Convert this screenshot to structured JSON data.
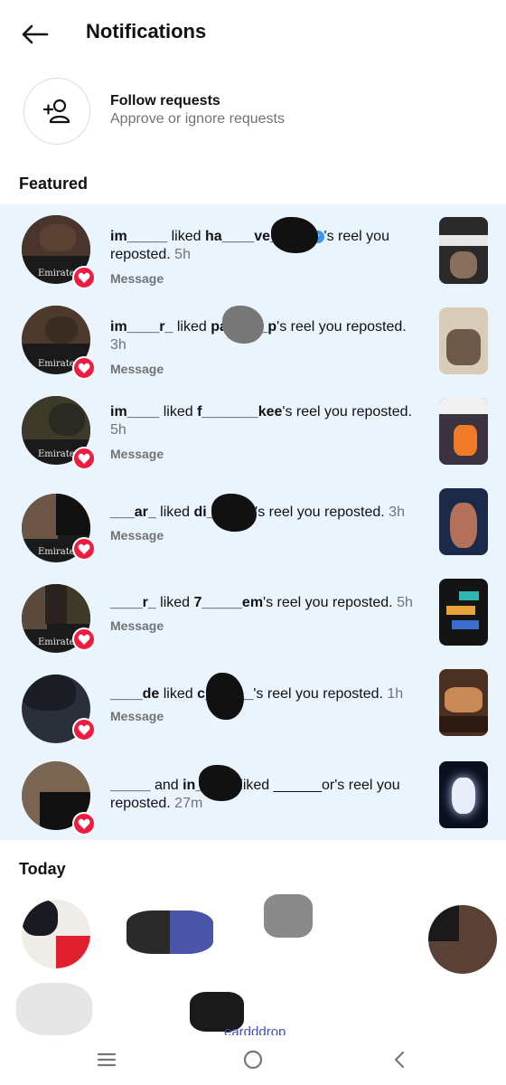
{
  "header": {
    "title": "Notifications",
    "back_icon": "arrow-left-icon"
  },
  "follow_requests": {
    "title": "Follow requests",
    "subtitle": "Approve or ignore requests",
    "icon": "add-person-icon"
  },
  "sections": {
    "featured": "Featured",
    "today": "Today"
  },
  "colors": {
    "featured_bg": "#e9f4fc",
    "heart_badge": "#ed1c40",
    "secondary_text": "#737373",
    "verified_blue": "#3897f0"
  },
  "featured": [
    {
      "user": "im_____",
      "verb": "liked",
      "target": "ha____ve____s",
      "rest": "'s reel you reposted.",
      "time": "5h",
      "message_label": "Message",
      "verified": true
    },
    {
      "user": "im____r_",
      "verb": "liked",
      "target": "pa_____p",
      "rest": "'s reel you reposted.",
      "time": "3h",
      "message_label": "Message",
      "verified": false
    },
    {
      "user": "im____",
      "verb": "liked",
      "target": "f_______kee",
      "rest": "'s reel you reposted.",
      "time": "5h",
      "message_label": "Message",
      "verified": false
    },
    {
      "user": "___ar_",
      "verb": "liked",
      "target": "di______",
      "rest": "'s reel you reposted.",
      "time": "3h",
      "message_label": "Message",
      "verified": false
    },
    {
      "user": "____r_",
      "verb": "liked",
      "target": "7_____em",
      "rest": "'s reel you reposted.",
      "time": "5h",
      "message_label": "Message",
      "verified": false
    },
    {
      "user": "____de",
      "verb": "liked",
      "target": "c______",
      "rest": "'s reel you reposted.",
      "time": "1h",
      "message_label": "Message",
      "verified": false
    },
    {
      "user": "_____",
      "verb": "and",
      "target": "in_____",
      "rest": "liked ______or's reel you reposted.",
      "time": "27m",
      "message_label": "",
      "verified": false
    }
  ],
  "today": {
    "partial_name": "eardddrop"
  },
  "navbar": {
    "menu_icon": "recent-apps-icon",
    "home_icon": "home-circle-icon",
    "back_icon": "back-chevron-icon"
  }
}
